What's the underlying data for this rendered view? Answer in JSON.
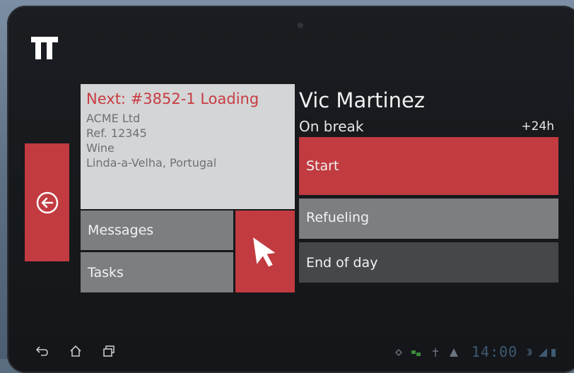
{
  "job": {
    "title": "Next: #3852-1 Loading",
    "lines": [
      "ACME Ltd",
      "Ref. 12345",
      "Wine",
      "Linda-a-Velha, Portugal"
    ]
  },
  "tiles": {
    "messages": "Messages",
    "tasks": "Tasks"
  },
  "driver": {
    "name": "Vic Martinez",
    "status": "On break",
    "hours": "+24h"
  },
  "actions": {
    "start": "Start",
    "refueling": "Refueling",
    "end_of_day": "End of day"
  },
  "system": {
    "clock": "14:00"
  },
  "icons": {
    "logo": "app-logo",
    "back": "back-arrow-circle-icon",
    "navigation": "navigation-pointer-icon",
    "sys_back": "system-back-icon",
    "sys_home": "system-home-icon",
    "sys_recent": "system-recent-apps-icon"
  },
  "colors": {
    "accent_red": "#c13b40",
    "title_red": "#c73c42",
    "tile_gray": "#7c7e80",
    "tile_dark": "#45474a",
    "card_light": "#d4d5d6"
  }
}
